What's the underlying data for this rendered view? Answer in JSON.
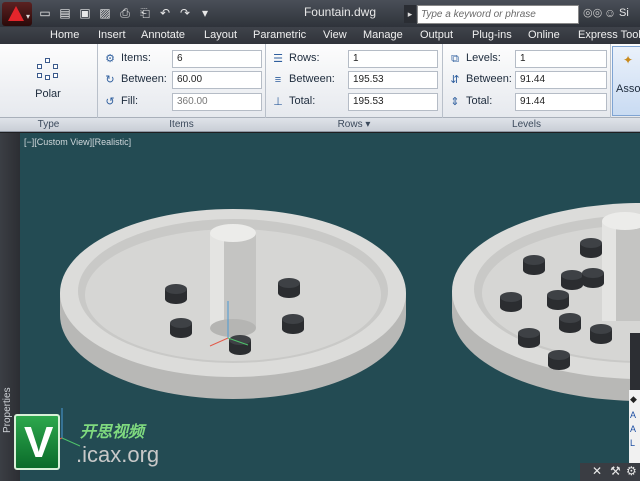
{
  "titlebar": {
    "document_title": "Fountain.dwg",
    "search_placeholder": "Type a keyword or phrase",
    "signin_label": "Si"
  },
  "ribbon_tabs": [
    "Home",
    "Insert",
    "Annotate",
    "Layout",
    "Parametric",
    "View",
    "Manage",
    "Output",
    "Plug-ins",
    "Online",
    "Express Tools"
  ],
  "type_panel": {
    "polar_label": "Polar",
    "panel_label": "Type"
  },
  "items_panel": {
    "panel_label": "Items",
    "items_label": "Items:",
    "items_value": "6",
    "between_label": "Between:",
    "between_value": "60.00",
    "fill_label": "Fill:",
    "fill_value": "360.00"
  },
  "rows_panel": {
    "panel_label": "Rows",
    "rows_label": "Rows:",
    "rows_value": "1",
    "between_label": "Between:",
    "between_value": "195.53",
    "total_label": "Total:",
    "total_value": "195.53"
  },
  "levels_panel": {
    "panel_label": "Levels",
    "levels_label": "Levels:",
    "levels_value": "1",
    "between_label": "Between:",
    "between_value": "91.44",
    "total_label": "Total:",
    "total_value": "91.44"
  },
  "associative_label": "Asso",
  "viewport": {
    "view_label": "[−][Custom View][Realistic]"
  },
  "properties_label": "Properties",
  "watermark": {
    "chinese_text": "开思视频",
    "url_text": ".icax.org"
  },
  "colors": {
    "viewport_bg": "#234b53",
    "ribbon_bg": "#f4f5f7",
    "titlebar_bg": "#3a3e45"
  }
}
